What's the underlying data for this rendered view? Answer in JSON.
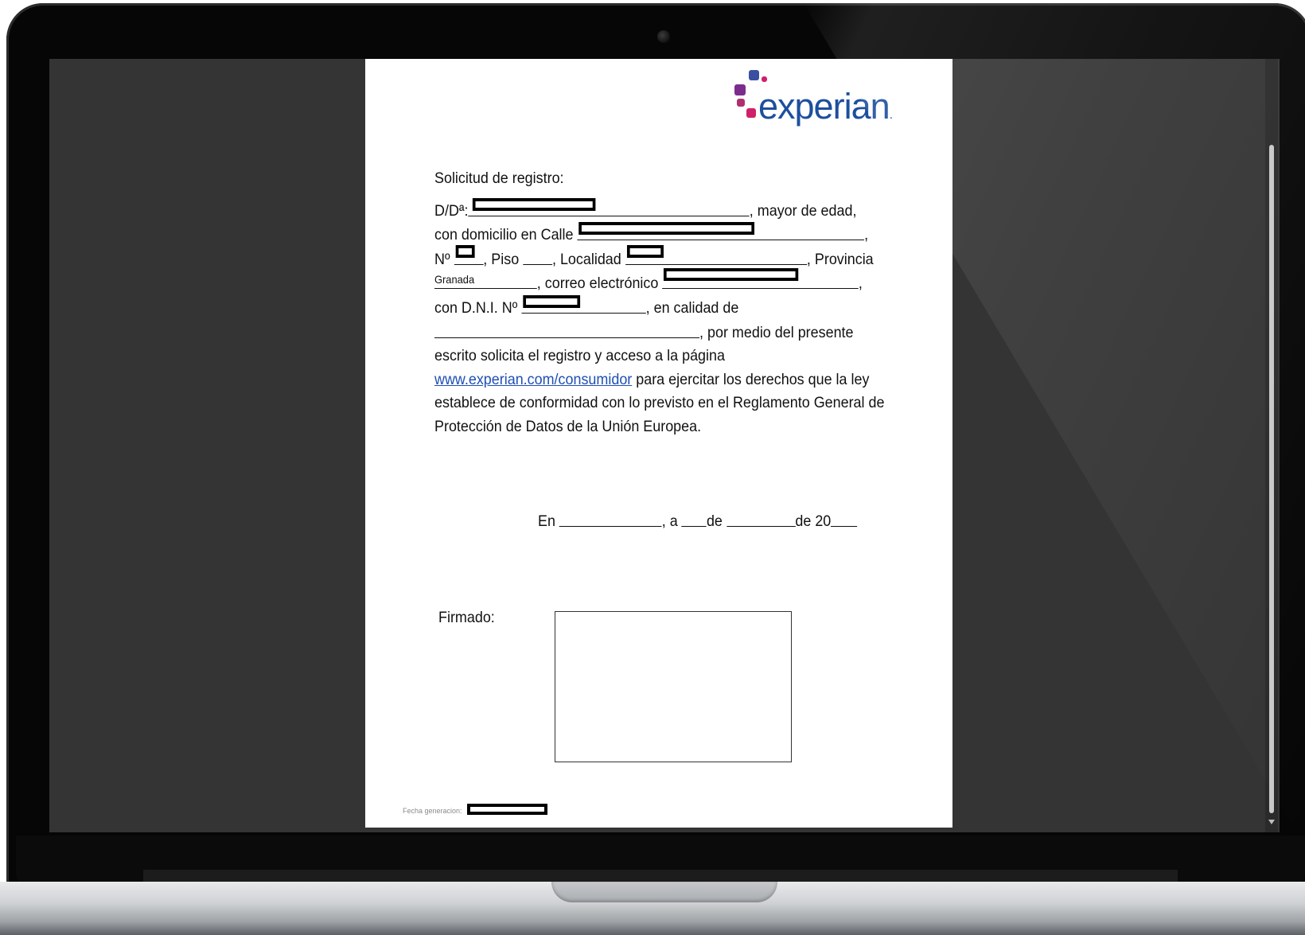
{
  "logo": {
    "text": "experian",
    "suffix": "."
  },
  "document": {
    "heading": "Solicitud de registro:",
    "line1": {
      "prefix": "D/Dª:",
      "suffix": ", mayor de edad,"
    },
    "line2": {
      "prefix": "con domicilio en Calle",
      "suffix": ","
    },
    "line3": {
      "prefix": "Nº",
      "piso": ", Piso",
      "localidad": ", Localidad",
      "provincia": ", Provincia"
    },
    "line4": {
      "province_value": "Granada",
      "email_label": ", correo electrónico",
      "suffix": ","
    },
    "line5": {
      "prefix": "con D.N.I. Nº",
      "suffix": ", en calidad de"
    },
    "line6": {
      "suffix": ", por medio del presente"
    },
    "line7": "escrito solicita el registro y acceso a la página",
    "line8": {
      "link": "www.experian.com/consumidor",
      "suffix": " para ejercitar los derechos que la ley"
    },
    "line9": "establece de conformidad con lo previsto en el Reglamento General de",
    "line10": "Protección de Datos de la Unión Europea.",
    "date_line": {
      "en": "En",
      "a": ", a",
      "de1": "de",
      "de2": "de 20"
    },
    "signed_label": "Firmado:",
    "generation_label": "Fecha generacion:"
  },
  "colors": {
    "logo_text": "#1d4f9e",
    "dot_blue": "#3a4fa0",
    "dot_purple": "#7b2d8e",
    "dot_pink": "#d0206a",
    "link": "#1f4fb5",
    "screen_bg": "#343434"
  }
}
